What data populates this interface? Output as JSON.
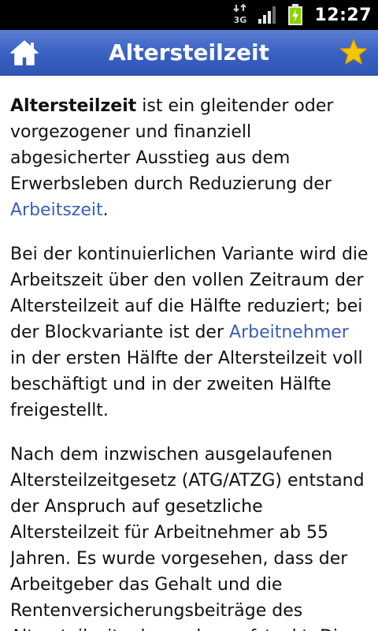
{
  "status_bar": {
    "network_label": "3G",
    "time": "12:27",
    "icons": [
      "3g-data-icon",
      "signal-strength-icon",
      "battery-charging-icon"
    ]
  },
  "app_bar": {
    "title": "Altersteilzeit",
    "home_icon": "home-icon",
    "favorite_icon": "star-icon",
    "background_color": "#3b62c3",
    "star_color": "#f5c400"
  },
  "article": {
    "link_color": "#3a5fb8",
    "paragraph1": {
      "bold_term": "Altersteilzeit",
      "text1": " ist ein gleitender oder vorgezogener und finanziell abgesicherter Ausstieg aus dem Erwerbsleben durch Reduzierung der ",
      "link1": "Arbeitszeit",
      "text2": "."
    },
    "paragraph2": {
      "text1": "Bei der kontinuierlichen Variante wird die Arbeitszeit über den vollen Zeitraum der Altersteilzeit auf die Hälfte reduziert; bei der Blockvariante ist der ",
      "link1": "Arbeitnehmer",
      "text2": " in der ersten Hälfte der Altersteilzeit voll beschäftigt und in der zweiten Hälfte freigestellt."
    },
    "paragraph3": {
      "text": "Nach dem inzwischen ausgelaufenen Altersteilzeitgesetz (ATG/ATZG) entstand der Anspruch auf gesetzliche Altersteilzeit für Arbeitnehmer ab 55 Jahren. Es wurde vorgesehen, dass der Arbeitgeber das Gehalt und die Rentenversicherungsbeiträge des Altersteilzeitnehmenden aufstockt. Diese"
    }
  }
}
